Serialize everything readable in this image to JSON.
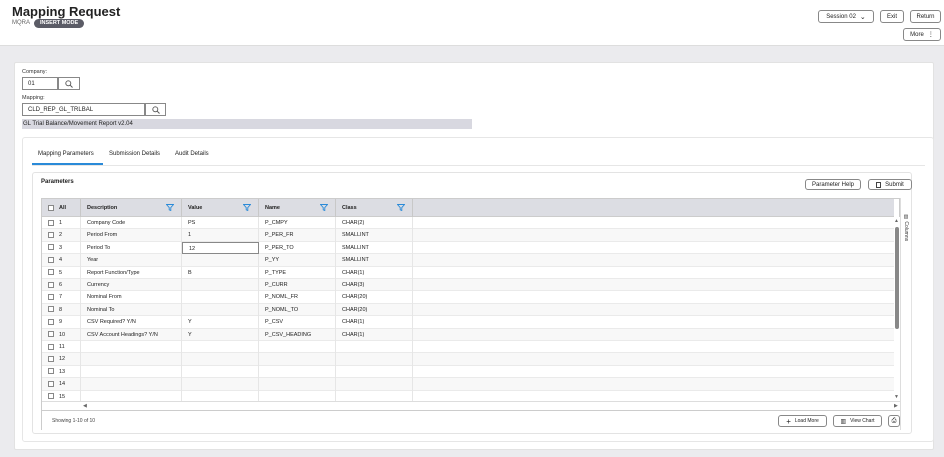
{
  "header": {
    "title": "Mapping Request",
    "code": "MQRA",
    "mode": "INSERT MODE",
    "session": "Session 02",
    "exit": "Exit",
    "return": "Return",
    "more": "More"
  },
  "form": {
    "company_label": "Company:",
    "company_value": "01",
    "mapping_label": "Mapping:",
    "mapping_value": "CLD_REP_GL_TRLBAL",
    "mapping_description": "GL Trial Balance/Movement Report v2.04"
  },
  "tabs": [
    {
      "label": "Mapping Parameters",
      "active": true
    },
    {
      "label": "Submission Details"
    },
    {
      "label": "Audit Details"
    }
  ],
  "parameters": {
    "title": "Parameters",
    "help": "Parameter Help",
    "submit": "Submit",
    "columns_label": "Columns",
    "headers": {
      "all": "All",
      "description": "Description",
      "value": "Value",
      "name": "Name",
      "class": "Class"
    },
    "rows": [
      {
        "n": "1",
        "description": "Company Code",
        "value": "PS",
        "name": "P_CMPY",
        "class": "CHAR(2)"
      },
      {
        "n": "2",
        "description": "Period From",
        "value": "1",
        "name": "P_PER_FR",
        "class": "SMALLINT"
      },
      {
        "n": "3",
        "description": "Period To",
        "value": "12",
        "name": "P_PER_TO",
        "class": "SMALLINT"
      },
      {
        "n": "4",
        "description": "Year",
        "value": "",
        "name": "P_YY",
        "class": "SMALLINT"
      },
      {
        "n": "5",
        "description": "Report Function/Type",
        "value": "B",
        "name": "P_TYPE",
        "class": "CHAR(1)"
      },
      {
        "n": "6",
        "description": "Currency",
        "value": "",
        "name": "P_CURR",
        "class": "CHAR(3)"
      },
      {
        "n": "7",
        "description": "Nominal From",
        "value": "",
        "name": "P_NOML_FR",
        "class": "CHAR(20)"
      },
      {
        "n": "8",
        "description": "Nominal To",
        "value": "",
        "name": "P_NOML_TO",
        "class": "CHAR(20)"
      },
      {
        "n": "9",
        "description": "CSV Required? Y/N",
        "value": "Y",
        "name": "P_CSV",
        "class": "CHAR(1)"
      },
      {
        "n": "10",
        "description": "CSV Account Headings? Y/N",
        "value": "Y",
        "name": "P_CSV_HEADING",
        "class": "CHAR(1)"
      },
      {
        "n": "11",
        "description": "",
        "value": "",
        "name": "",
        "class": ""
      },
      {
        "n": "12",
        "description": "",
        "value": "",
        "name": "",
        "class": ""
      },
      {
        "n": "13",
        "description": "",
        "value": "",
        "name": "",
        "class": ""
      },
      {
        "n": "14",
        "description": "",
        "value": "",
        "name": "",
        "class": ""
      },
      {
        "n": "15",
        "description": "",
        "value": "",
        "name": "",
        "class": ""
      }
    ],
    "showing": "Showing 1-10 of 10",
    "load_more": "Load More",
    "view_chart": "View Chart"
  }
}
